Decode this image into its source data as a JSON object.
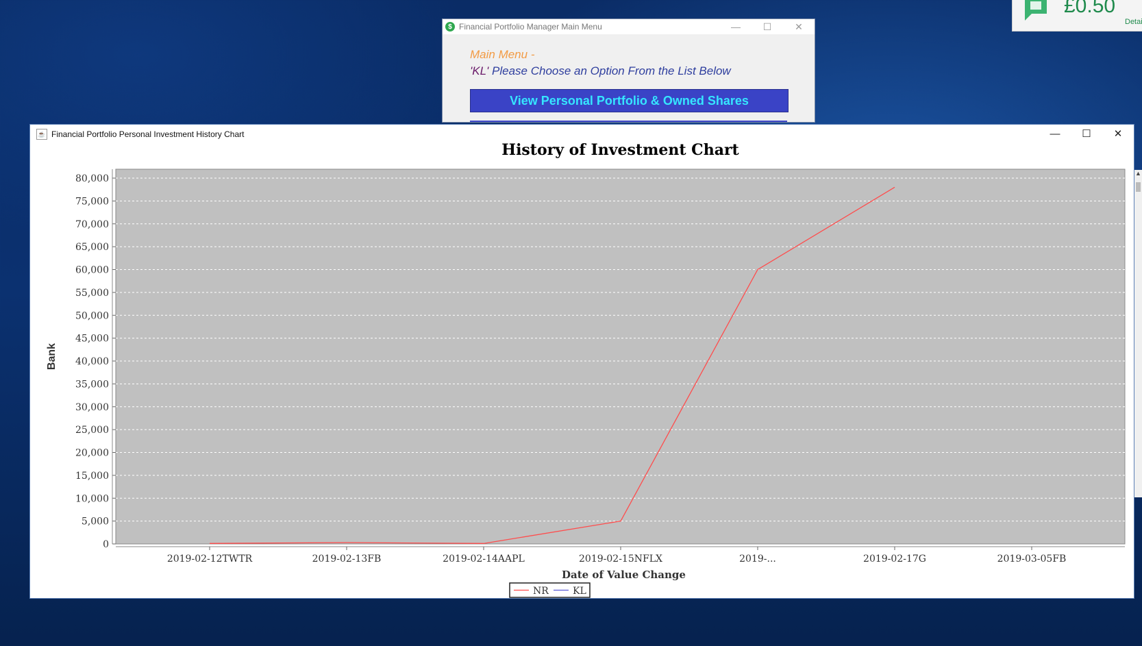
{
  "menu_window": {
    "title": "Financial Portfolio Manager Main Menu",
    "heading": "Main Menu -",
    "user": "'KL'",
    "prompt": " Please Choose an Option From the List Below",
    "button_view_portfolio": "View Personal Portfolio & Owned Shares"
  },
  "notification": {
    "amount": "£0.50",
    "details_label": "Detail"
  },
  "chart_window": {
    "title": "Financial Portfolio Personal Investment History Chart"
  },
  "colors": {
    "series_nr": "#ff4c4c",
    "series_kl": "#5a5ad6",
    "plot_background": "#c0c0c0"
  },
  "chart_data": {
    "type": "line",
    "title": "History of Investment Chart",
    "xlabel": "Date of Value Change",
    "ylabel": "Bank",
    "categories": [
      "2019-02-12TWTR",
      "2019-02-13FB",
      "2019-02-14AAPL",
      "2019-02-15NFLX",
      "2019-...",
      "2019-02-17G",
      "2019-03-05FB"
    ],
    "series": [
      {
        "name": "NR",
        "values": [
          100,
          300,
          100,
          5000,
          60000,
          78000,
          null
        ]
      },
      {
        "name": "KL",
        "values": [
          null,
          null,
          null,
          null,
          null,
          null,
          null
        ]
      }
    ],
    "ylim": [
      0,
      80000
    ],
    "yticks": [
      0,
      5000,
      10000,
      15000,
      20000,
      25000,
      30000,
      35000,
      40000,
      45000,
      50000,
      55000,
      60000,
      65000,
      70000,
      75000,
      80000
    ],
    "ytick_labels": [
      "0",
      "5,000",
      "10,000",
      "15,000",
      "20,000",
      "25,000",
      "30,000",
      "35,000",
      "40,000",
      "45,000",
      "50,000",
      "55,000",
      "60,000",
      "65,000",
      "70,000",
      "75,000",
      "80,000"
    ],
    "grid": true,
    "legend": "bottom-center"
  }
}
